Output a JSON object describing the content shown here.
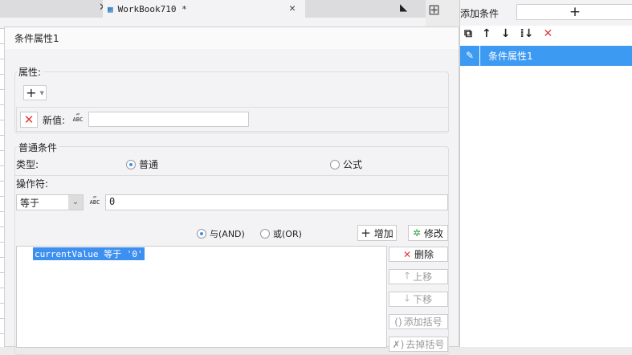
{
  "tabs": {
    "workbook_title": "WorkBook710 *"
  },
  "dialog": {
    "title": "条件属性1",
    "attributes": {
      "label": "属性:",
      "new_value_label": "新值:",
      "new_value": ""
    },
    "normal": {
      "label": "普通条件",
      "type_label": "类型:",
      "type_normal": "普通",
      "type_formula": "公式",
      "operator_label": "操作符:",
      "operator_value": "等于",
      "operand_value": "0"
    },
    "logic": {
      "and_label": "与(AND)",
      "or_label": "或(OR)",
      "add": "增加",
      "modify": "修改"
    },
    "conditions": [
      "currentValue 等于 '0'"
    ],
    "side_buttons": {
      "delete": "删除",
      "up": "上移",
      "down": "下移",
      "add_bracket": "添加括号",
      "remove_bracket": "去掉括号"
    },
    "abc_icon": "ABC"
  },
  "right_panel": {
    "add_condition_label": "添加条件",
    "items": [
      "条件属性1"
    ]
  }
}
